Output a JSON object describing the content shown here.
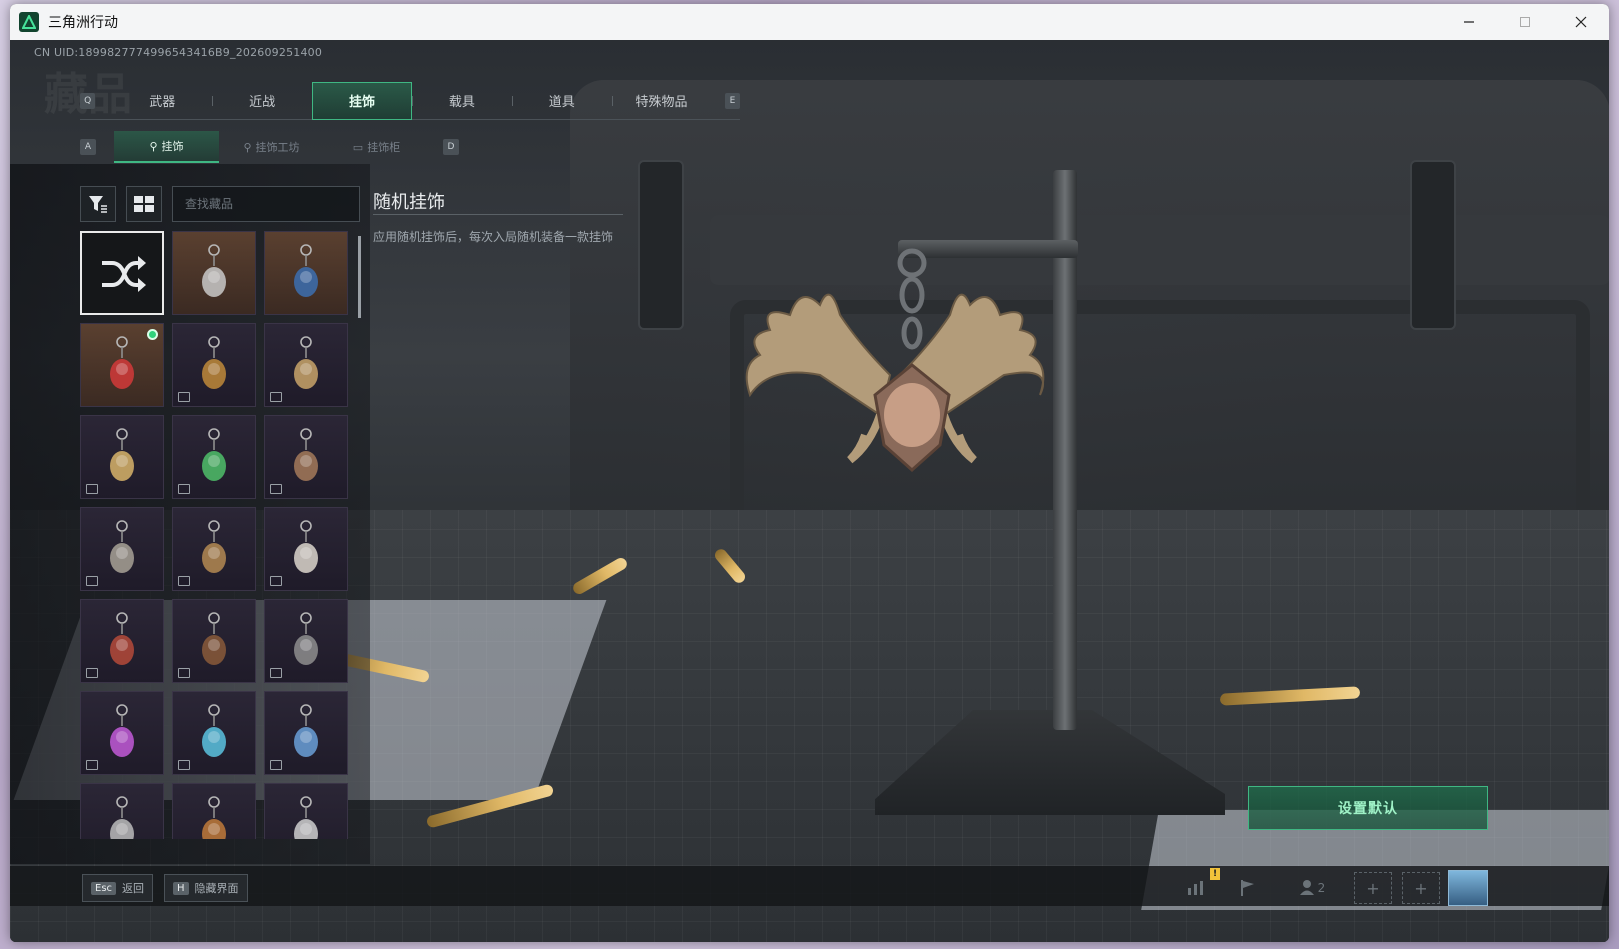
{
  "window": {
    "title": "三角洲行动",
    "minimize": "—",
    "maximize": "☐",
    "close": "✕"
  },
  "uid": "CN UID:1899827774996543416B9_202609251400",
  "watermark": "藏品",
  "tabs": {
    "left_key": "Q",
    "right_key": "E",
    "items": [
      {
        "label": "武器"
      },
      {
        "label": "近战"
      },
      {
        "label": "挂饰"
      },
      {
        "label": "载具"
      },
      {
        "label": "道具"
      },
      {
        "label": "特殊物品"
      }
    ],
    "active_index": 2
  },
  "subtabs": {
    "left_key": "A",
    "right_key": "D",
    "items": [
      {
        "label": "挂饰"
      },
      {
        "label": "挂饰工坊"
      },
      {
        "label": "挂饰柜"
      }
    ],
    "active_index": 0
  },
  "search": {
    "placeholder": "查找藏品"
  },
  "grid": {
    "selected_index": 0,
    "equipped_index": 3,
    "items": [
      {
        "icon": "shuffle-icon"
      },
      {
        "icon": "charm-icon",
        "accent": "#c9c9c9"
      },
      {
        "icon": "charm-icon",
        "accent": "#3c6fb0"
      },
      {
        "icon": "charm-icon",
        "accent": "#d23a3a"
      },
      {
        "icon": "charm-icon",
        "accent": "#c08a3a"
      },
      {
        "icon": "charm-icon",
        "accent": "#c9a56a"
      },
      {
        "icon": "charm-icon",
        "accent": "#d8b46a"
      },
      {
        "icon": "charm-icon",
        "accent": "#4fbf6a"
      },
      {
        "icon": "charm-icon",
        "accent": "#a57a5a"
      },
      {
        "icon": "charm-icon",
        "accent": "#a8a296"
      },
      {
        "icon": "charm-icon",
        "accent": "#b48a52"
      },
      {
        "icon": "charm-icon",
        "accent": "#dcd6cc"
      },
      {
        "icon": "charm-icon",
        "accent": "#b54a3a"
      },
      {
        "icon": "charm-icon",
        "accent": "#8a5a3a"
      },
      {
        "icon": "charm-icon",
        "accent": "#8e8e8e"
      },
      {
        "icon": "charm-icon",
        "accent": "#c25ad8"
      },
      {
        "icon": "charm-icon",
        "accent": "#5ac3e0"
      },
      {
        "icon": "charm-icon",
        "accent": "#6aa0d8"
      },
      {
        "icon": "charm-icon",
        "accent": "#bbbbbb"
      },
      {
        "icon": "charm-icon",
        "accent": "#c07a3a"
      },
      {
        "icon": "charm-icon",
        "accent": "#cfcfcf"
      }
    ]
  },
  "detail": {
    "title": "随机挂饰",
    "description": "应用随机挂饰后，每次入局随机装备一款挂饰"
  },
  "default_button": "设置默认",
  "bottom": {
    "back_key": "Esc",
    "back_label": "返回",
    "hide_key": "H",
    "hide_label": "隐藏界面",
    "squad_count": "2",
    "warn_mark": "!",
    "slot_plus": "+"
  },
  "colors": {
    "accent_green": "#3fb783",
    "equipped_green": "#2fd17b"
  }
}
